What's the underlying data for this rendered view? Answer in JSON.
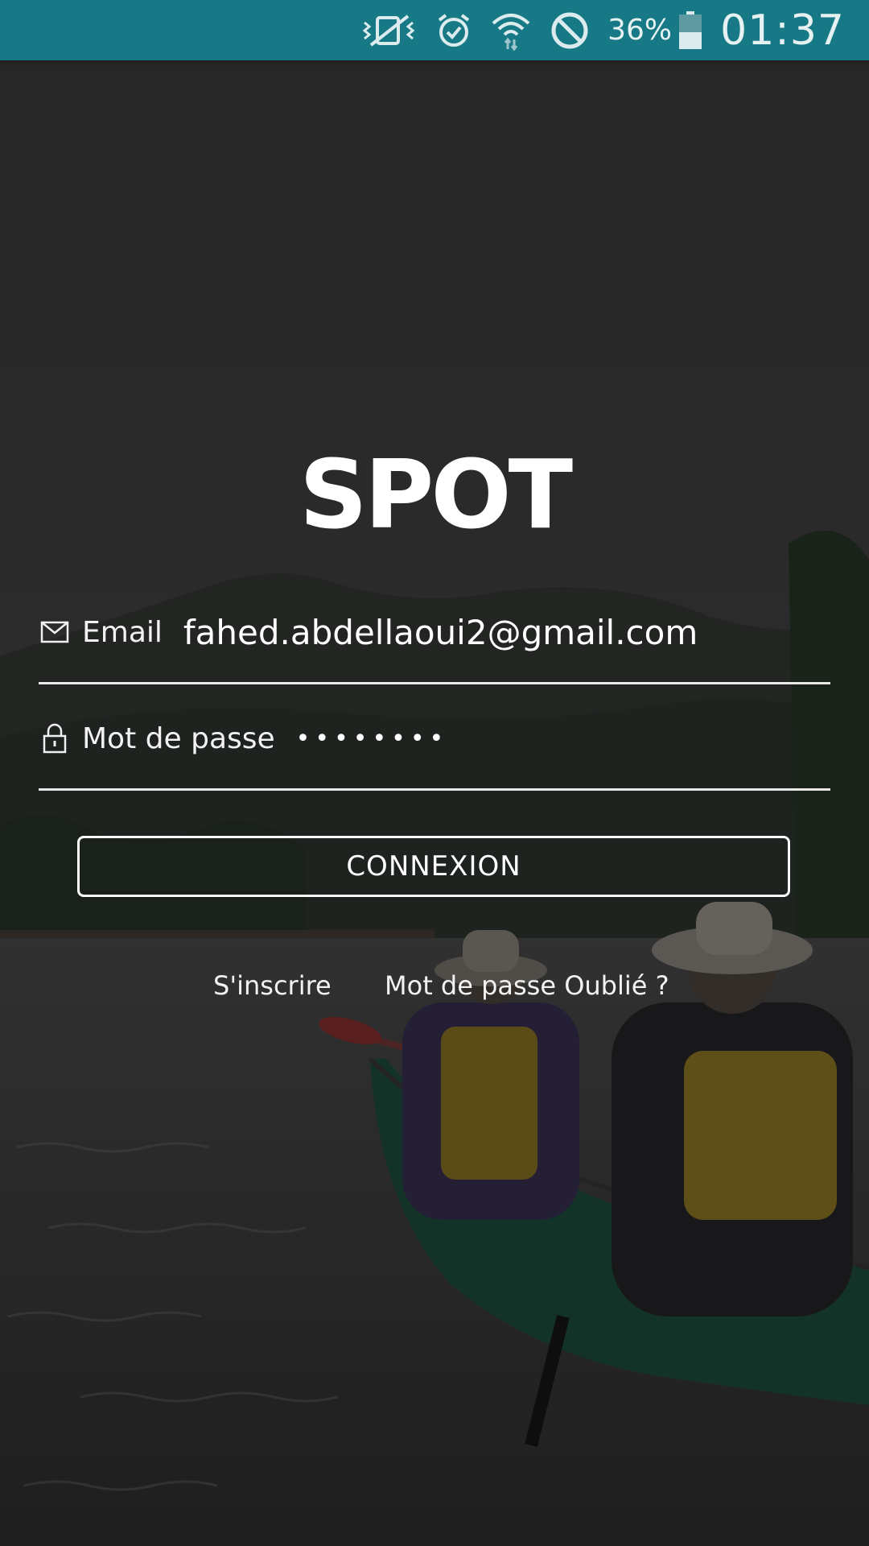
{
  "status_bar": {
    "battery_percent": "36%",
    "time": "01:37",
    "icons": [
      "vibrate-mute-icon",
      "alarm-icon",
      "wifi-icon",
      "do-not-disturb-icon",
      "battery-icon"
    ]
  },
  "login": {
    "logo_text": "SPOT",
    "email": {
      "label": "Email",
      "value": "fahed.abdellaoui2@gmail.com"
    },
    "password": {
      "label": "Mot de passe",
      "masked_value": "••••••••"
    },
    "connect_button": "CONNEXION",
    "signup_link": "S'inscrire",
    "forgot_link": "Mot de passe Oublié ?"
  },
  "colors": {
    "status_bar": "#177886",
    "text": "#ffffff"
  }
}
